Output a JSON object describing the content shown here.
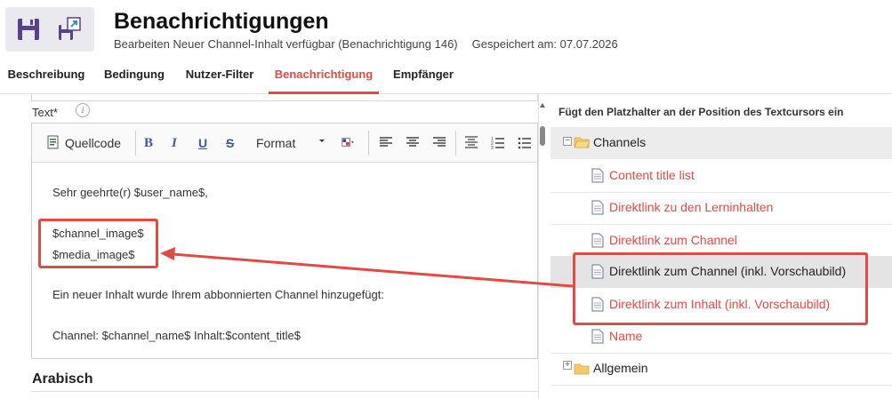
{
  "header": {
    "title": "Benachrichtigungen",
    "subtitle": "Bearbeiten Neuer Channel-Inhalt verfügbar (Benachrichtigung 146)",
    "saved": "Gespeichert am: 07.07.2026",
    "icons": [
      "save-icon",
      "export-icon"
    ]
  },
  "tabs": [
    {
      "label": "Beschreibung"
    },
    {
      "label": "Bedingung"
    },
    {
      "label": "Nutzer-Filter"
    },
    {
      "label": "Benachrichtigung",
      "active": true
    },
    {
      "label": "Empfänger"
    }
  ],
  "editor": {
    "field_label": "Text*",
    "info_icon": "i",
    "toolbar": {
      "source": "Quellcode",
      "bold": "B",
      "italic": "I",
      "underline": "U",
      "strike": "S",
      "format": "Format"
    },
    "lines": [
      "Sehr geehrte(r) $user_name$,",
      "$channel_image$",
      "$media_image$",
      "Ein neuer Inhalt wurde Ihrem abbonnierten Channel hinzugefügt:",
      "Channel: $channel_name$ Inhalt:$content_title$"
    ]
  },
  "section": {
    "arabisch": "Arabisch"
  },
  "placeholder_panel": {
    "title": "Fügt den Platzhalter an der Position des Textcursors ein",
    "groups": [
      {
        "label": "Channels",
        "expanded": true,
        "items": [
          {
            "label": "Content title list"
          },
          {
            "label": "Direktlink zu den Lerninhalten"
          },
          {
            "label": "Direktlink zum Channel"
          },
          {
            "label": "Direktlink zum Channel (inkl. Vorschaubild)",
            "selected": true
          },
          {
            "label": "Direktlink zum Inhalt (inkl. Vorschaubild)"
          },
          {
            "label": "Name"
          }
        ]
      },
      {
        "label": "Allgemein",
        "expanded": false
      }
    ]
  },
  "colors": {
    "accent": "#e24a45",
    "tab_active": "#e24a45",
    "format_buttons": "#3a5a9c"
  }
}
